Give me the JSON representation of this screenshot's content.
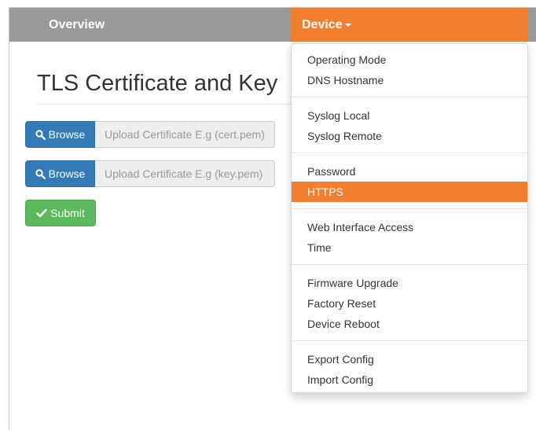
{
  "navbar": {
    "overview_label": "Overview",
    "device_label": "Device"
  },
  "page": {
    "title": "TLS Certificate and Key"
  },
  "uploads": {
    "cert": {
      "button_label": "Browse",
      "placeholder": "Upload Certificate E.g (cert.pem)"
    },
    "key": {
      "button_label": "Browse",
      "placeholder": "Upload Certificate E.g (key.pem)"
    }
  },
  "submit_label": "Submit",
  "dropdown": {
    "active_item": "HTTPS",
    "items": [
      "Operating Mode",
      "DNS Hostname",
      "Syslog Local",
      "Syslog Remote",
      "Password",
      "HTTPS",
      "Web Interface Access",
      "Time",
      "Firmware Upgrade",
      "Factory Reset",
      "Device Reboot",
      "Export Config",
      "Import Config"
    ]
  },
  "colors": {
    "navbar": "#9a9a9a",
    "accent_orange": "#f27f30",
    "browse_blue": "#337ab7",
    "submit_green": "#5cb85c"
  },
  "icons": {
    "browse": "search-icon",
    "submit": "checkmark-icon",
    "device": "caret-down-icon"
  }
}
